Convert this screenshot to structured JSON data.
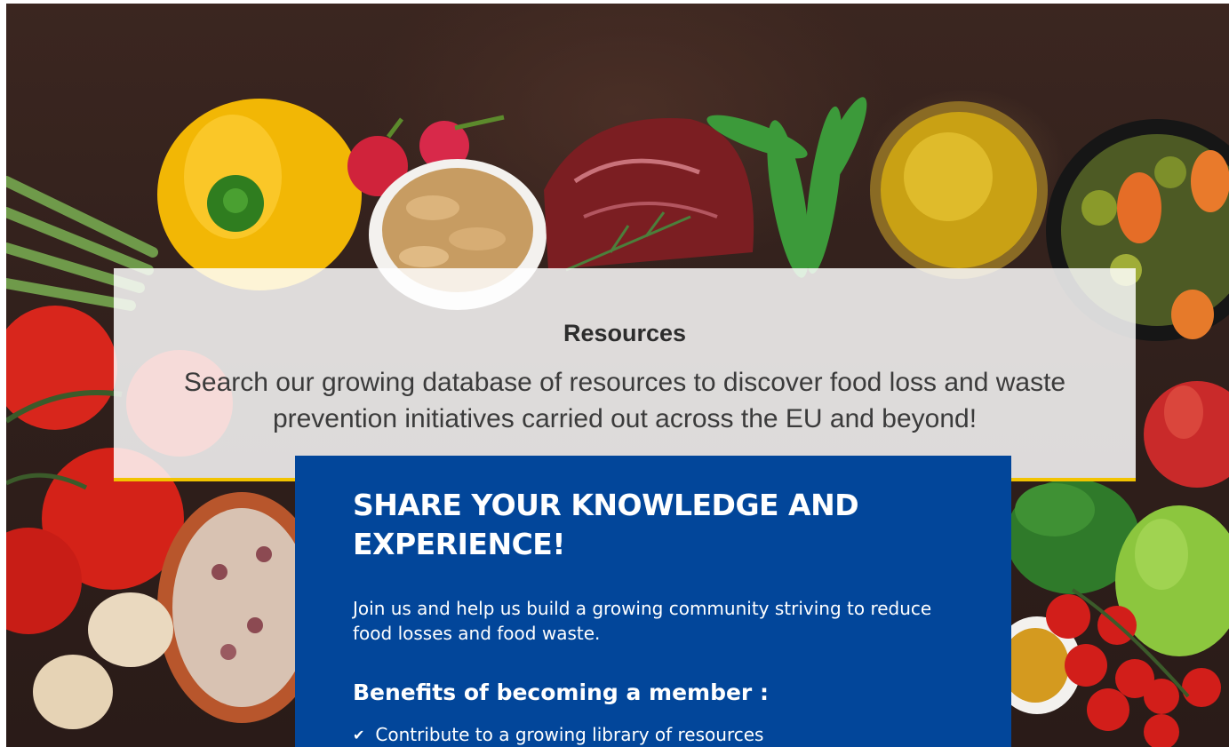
{
  "resources": {
    "title": "Resources",
    "description": "Search our growing database of resources to discover food loss and waste prevention initiatives carried out across the EU and beyond!"
  },
  "share": {
    "title": "SHARE YOUR KNOWLEDGE AND EXPERIENCE!",
    "intro": "Join us and help us build a growing community striving to reduce food losses and food waste.",
    "benefits_title": "Benefits of becoming a member :",
    "benefits": [
      {
        "icon": "check-icon",
        "label": "Contribute to a growing library of resources"
      }
    ]
  },
  "colors": {
    "card_blue": "#02469a",
    "accent_yellow": "#f2c300",
    "panel_white": "#ffffff"
  },
  "hero_image": {
    "icon": "food-photo",
    "items": [
      "yellow-pepper",
      "radish",
      "peanuts",
      "raw-meat",
      "green-beans",
      "olive-oil",
      "olives",
      "asparagus",
      "tomatoes",
      "beans",
      "garlic",
      "apple",
      "pear",
      "cherry-tomatoes",
      "spinach",
      "spice"
    ]
  }
}
